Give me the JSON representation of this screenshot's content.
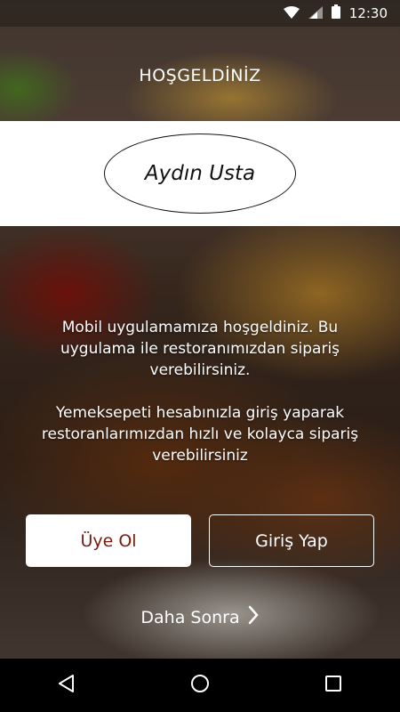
{
  "status_bar": {
    "time": "12:30",
    "icons": [
      "wifi-icon",
      "signal-icon",
      "battery-icon"
    ]
  },
  "welcome": {
    "title": "HOŞGELDİNİZ"
  },
  "logo": {
    "text": "Aydın Usta"
  },
  "intro": {
    "paragraph1": "Mobil uygulamamıza hoşgeldiniz. Bu uygulama ile restoranımızdan sipariş verebilirsiniz.",
    "paragraph2": "Yemeksepeti hesabınızla giriş yaparak restoranlarımızdan hızlı ve kolayca sipariş verebilirsiniz"
  },
  "actions": {
    "register_label": "Üye Ol",
    "login_label": "Giriş Yap",
    "later_label": "Daha Sonra"
  },
  "nav": {
    "icons": [
      "back-icon",
      "home-icon",
      "recents-icon"
    ]
  },
  "colors": {
    "register_text": "#7a1a0a",
    "logo_band": "#ffffff",
    "nav_bar": "#000000"
  }
}
